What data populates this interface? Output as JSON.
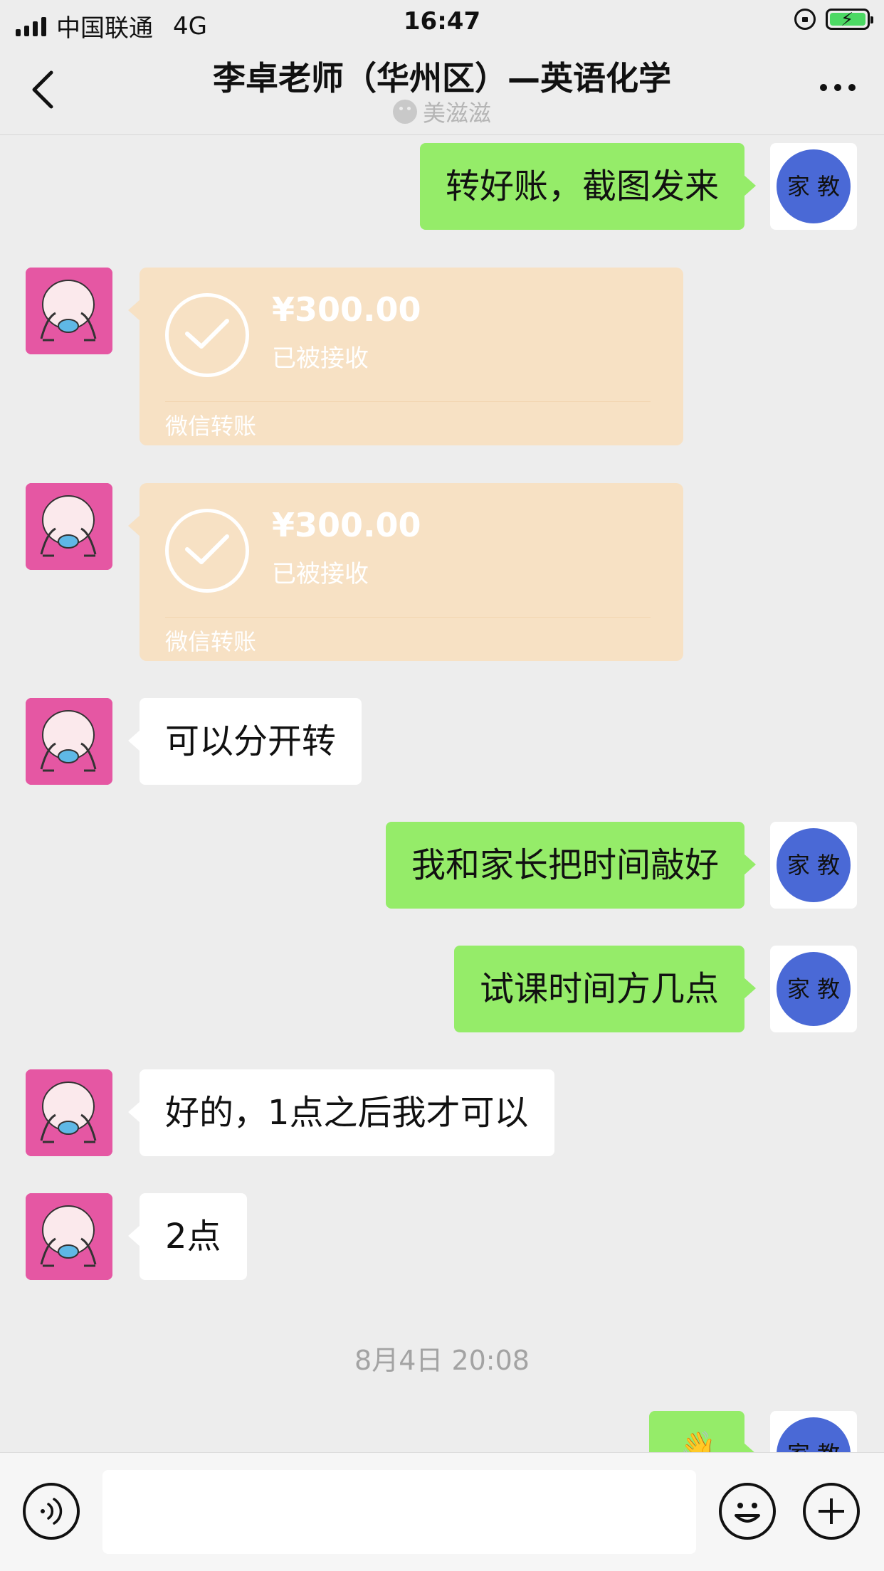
{
  "status_bar": {
    "carrier": "中国联通",
    "network": "4G",
    "time": "16:47",
    "icons": [
      "signal-icon",
      "orientation-lock-icon",
      "battery-charging-icon"
    ]
  },
  "nav": {
    "title": "李卓老师（华州区）—英语化学",
    "subtitle": "美滋滋",
    "icons": [
      "back-icon",
      "more-icon"
    ]
  },
  "messages": {
    "m1": "转好账，截图发来",
    "t1": {
      "amount": "¥300.00",
      "status": "已被接收",
      "label": "微信转账"
    },
    "t2": {
      "amount": "¥300.00",
      "status": "已被接收",
      "label": "微信转账"
    },
    "m2": "可以分开转",
    "m3": "我和家长把时间敲好",
    "m4": "试课时间方几点",
    "m5": "好的，1点之后我才可以",
    "m6": "2点",
    "timestamp": "8月4日 20:08"
  },
  "avatars": {
    "self_text": "家 教",
    "self_color": "#4a69d6",
    "other_color": "#e557a3"
  },
  "colors": {
    "self_bubble": "#95ec69",
    "other_bubble": "#ffffff",
    "transfer_card": "#f7e1c4",
    "background": "#ededed"
  },
  "input_bar": {
    "placeholder": "",
    "icons": [
      "voice-icon",
      "emoji-icon",
      "plus-icon"
    ]
  }
}
